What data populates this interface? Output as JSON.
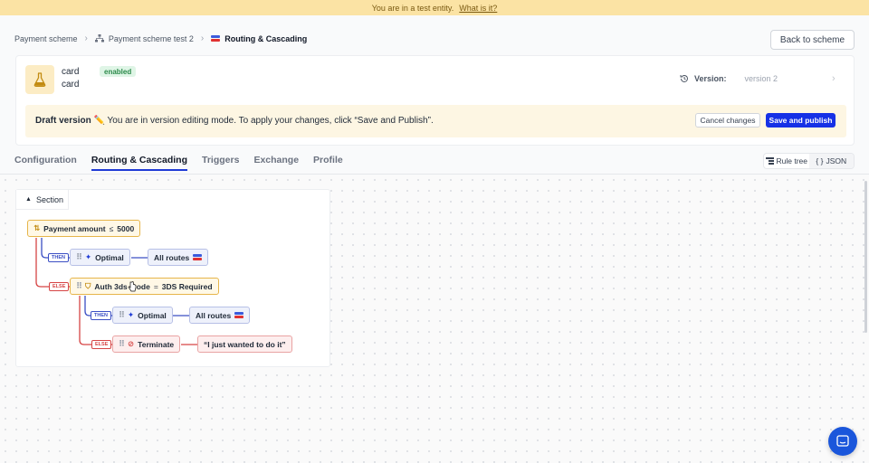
{
  "banner": {
    "text": "You are in a test entity.",
    "link": "What is it?"
  },
  "breadcrumb": {
    "item1": "Payment scheme",
    "item2": "Payment scheme test 2",
    "item3": "Routing & Cascading"
  },
  "back_button": "Back to scheme",
  "scheme": {
    "name": "card",
    "subtitle": "card",
    "status": "enabled",
    "version_label": "Version:",
    "version_value": "version 2"
  },
  "draft": {
    "title": "Draft version ✏️",
    "message": " You are in version editing mode. To apply your changes, click “Save and Publish”.",
    "cancel": "Cancel changes",
    "publish": "Save and publish"
  },
  "tabs": [
    {
      "label": "Configuration"
    },
    {
      "label": "Routing & Cascading"
    },
    {
      "label": "Triggers"
    },
    {
      "label": "Exchange"
    },
    {
      "label": "Profile"
    }
  ],
  "view_toggle": {
    "rule_tree": "Rule tree",
    "json": "JSON"
  },
  "tree": {
    "section": "Section",
    "nodes": {
      "n1": {
        "label": "Payment amount",
        "op": "≤",
        "value": "5000"
      },
      "n2": {
        "label": "Optimal"
      },
      "n3": {
        "label": "All routes"
      },
      "n4": {
        "label": "Auth 3ds mode",
        "op": "=",
        "value": "3DS Required"
      },
      "n5": {
        "label": "Optimal"
      },
      "n6": {
        "label": "All routes"
      },
      "n7": {
        "label": "Terminate"
      },
      "n8": {
        "label": "“I just wanted to do it”"
      }
    },
    "tags": {
      "then": "THEN",
      "else": "ELSE"
    }
  },
  "colors": {
    "accent": "#1631e6",
    "banner": "#fbe3a4",
    "then": "#3b4fc4",
    "else": "#d64545",
    "condition": "#e6b54a"
  }
}
